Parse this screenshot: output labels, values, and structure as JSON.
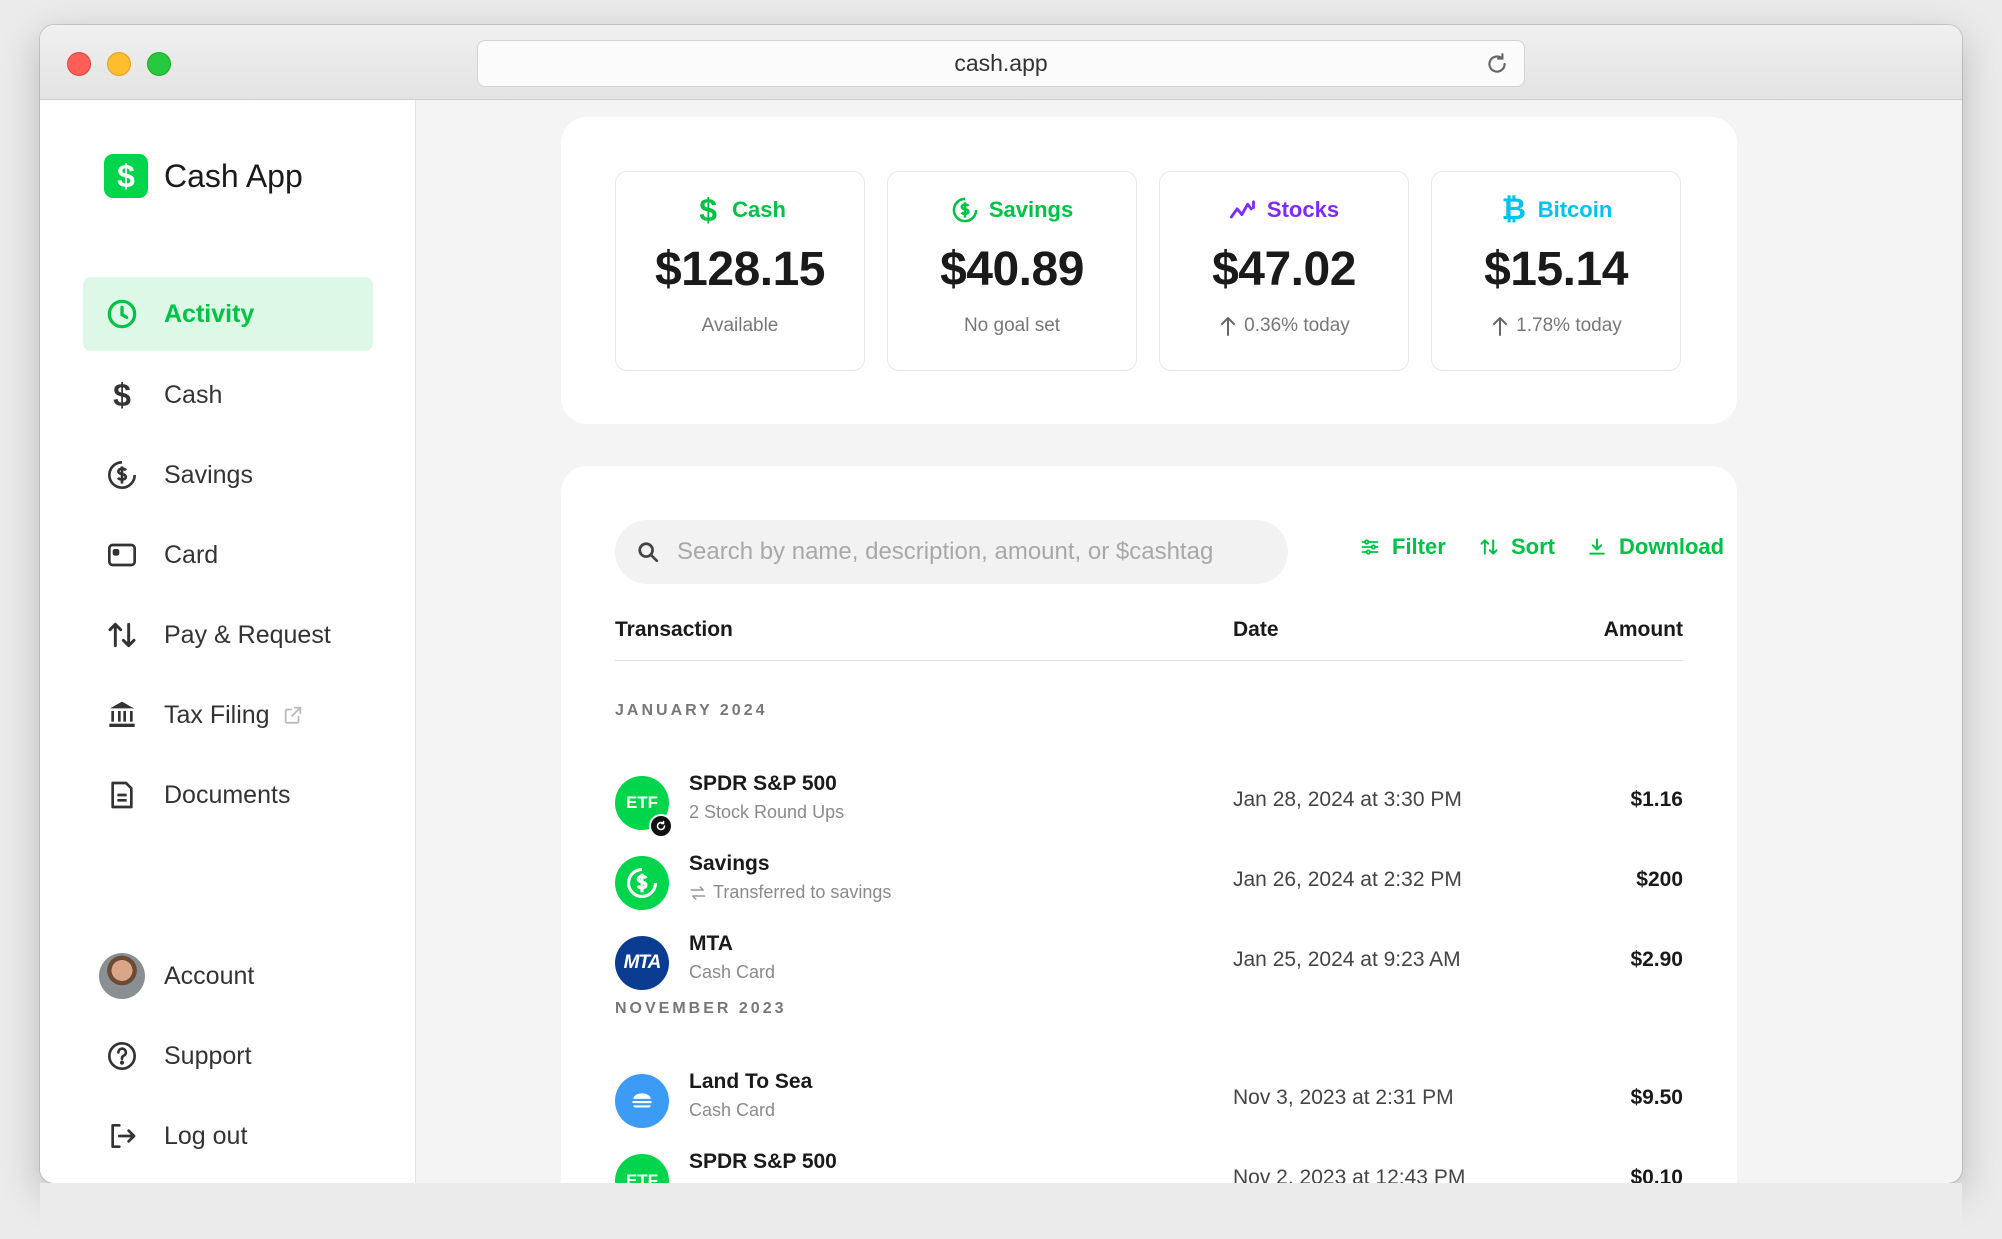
{
  "browser": {
    "url": "cash.app"
  },
  "brand": {
    "logo_glyph": "$",
    "name": "Cash App",
    "color": "#00d54b"
  },
  "sidebar": {
    "items": [
      {
        "label": "Activity",
        "icon": "clock-icon",
        "active": true
      },
      {
        "label": "Cash",
        "icon": "dollar-icon"
      },
      {
        "label": "Savings",
        "icon": "savings-icon"
      },
      {
        "label": "Card",
        "icon": "card-icon"
      },
      {
        "label": "Pay & Request",
        "icon": "pay-request-icon"
      },
      {
        "label": "Tax Filing",
        "icon": "bank-icon",
        "external": true
      },
      {
        "label": "Documents",
        "icon": "document-icon"
      }
    ],
    "bottom": [
      {
        "label": "Account",
        "icon": "avatar"
      },
      {
        "label": "Support",
        "icon": "help-icon"
      },
      {
        "label": "Log out",
        "icon": "logout-icon"
      }
    ]
  },
  "balances": [
    {
      "label": "Cash",
      "amount": "$128.15",
      "sub": "Available",
      "color": "#00c244",
      "icon": "dollar-icon"
    },
    {
      "label": "Savings",
      "amount": "$40.89",
      "sub": "No goal set",
      "color": "#00c244",
      "icon": "savings-icon"
    },
    {
      "label": "Stocks",
      "amount": "$47.02",
      "sub": "0.36% today",
      "color": "#7d2bf5",
      "icon": "stocks-trend-icon",
      "trend": "up"
    },
    {
      "label": "Bitcoin",
      "amount": "$15.14",
      "sub": "1.78% today",
      "color": "#00c3f0",
      "icon": "bitcoin-icon",
      "trend": "up"
    }
  ],
  "activity": {
    "search_placeholder": "Search by name, description, amount, or $cashtag",
    "tools": {
      "filter": "Filter",
      "sort": "Sort",
      "download": "Download"
    },
    "columns": {
      "transaction": "Transaction",
      "date": "Date",
      "amount": "Amount"
    },
    "groups": [
      {
        "month": "JANUARY 2024",
        "rows": [
          {
            "icon_text": "ETF",
            "icon_color": "#00d54b",
            "name": "SPDR S&P 500",
            "desc": "2 Stock Round Ups",
            "date": "Jan 28, 2024 at 3:30 PM",
            "amount": "$1.16"
          },
          {
            "icon_text": "",
            "icon_color": "#00d54b",
            "name": "Savings",
            "desc": "Transferred to savings",
            "date": "Jan 26, 2024 at 2:32 PM",
            "amount": "$200"
          },
          {
            "icon_text": "MTA",
            "icon_color": "#0a3d91",
            "name": "MTA",
            "desc": "Cash Card",
            "date": "Jan 25, 2024 at 9:23 AM",
            "amount": "$2.90"
          }
        ]
      },
      {
        "month": "NOVEMBER 2023",
        "rows": [
          {
            "icon_text": "",
            "icon_color": "#3b9bf5",
            "name": "Land To Sea",
            "desc": "Cash Card",
            "date": "Nov 3, 2023 at 2:31 PM",
            "amount": "$9.50"
          },
          {
            "icon_text": "ETF",
            "icon_color": "#00d54b",
            "name": "SPDR S&P 500",
            "desc": "",
            "date": "Nov 2, 2023 at 12:43 PM",
            "amount": "$0.10"
          }
        ]
      }
    ]
  }
}
